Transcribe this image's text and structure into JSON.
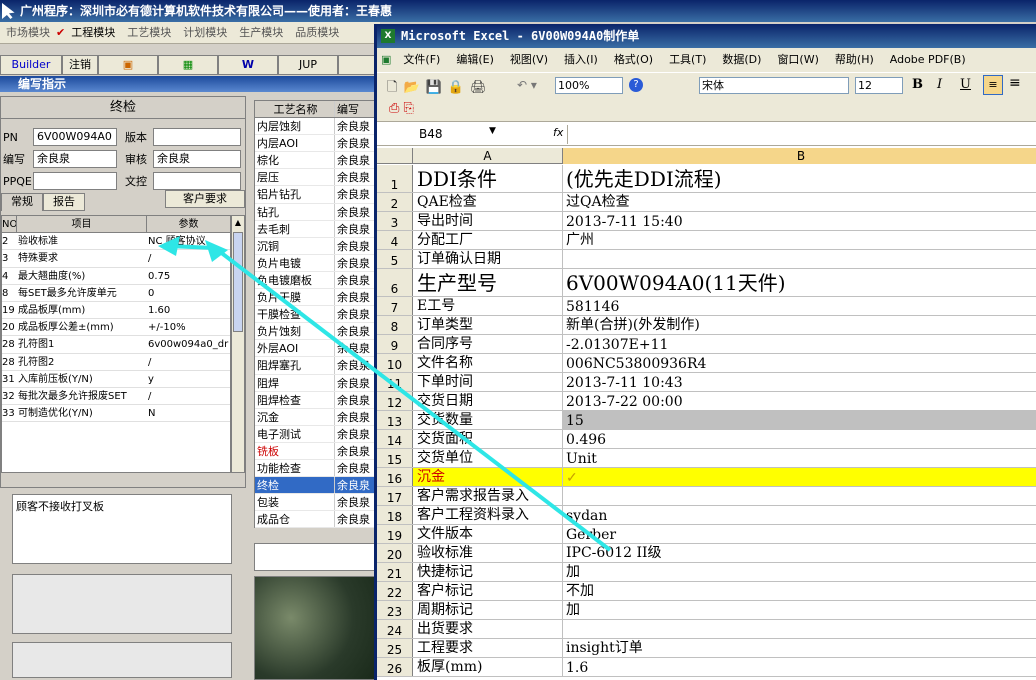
{
  "back_window": {
    "title": "广州程序：深圳市必有德计算机软件技术有限公司——使用者：王春惠",
    "menu": [
      "市场模块",
      "工程模块",
      "工艺模块",
      "计划模块",
      "生产模块",
      "品质模块"
    ],
    "toolbar": [
      "Builder",
      "注销",
      "",
      "",
      "",
      "JUP",
      ""
    ],
    "section_title": "编写指示",
    "form": {
      "header": "终检",
      "pn_label": "PN",
      "pn_value": "6V00W094A0",
      "version_label": "版本",
      "version_value": "",
      "author_label": "编写",
      "author_value": "余良泉",
      "review_label": "审核",
      "review_value": "余良泉",
      "ppqe_label": "PPQE",
      "ppqe_value": "",
      "doc_label": "文控",
      "doc_value": "",
      "tabs": [
        "常规",
        "报告",
        "客户要求"
      ],
      "grid_headers": [
        "NO",
        "项目",
        "参数"
      ],
      "grid_rows": [
        {
          "no": "2",
          "item": "验收标准",
          "param": "NC 顾客协议"
        },
        {
          "no": "3",
          "item": "特殊要求",
          "param": "/"
        },
        {
          "no": "4",
          "item": "最大翘曲度(%)",
          "param": "0.75"
        },
        {
          "no": "8",
          "item": "每SET最多允许废单元",
          "param": "0"
        },
        {
          "no": "19",
          "item": "成品板厚(mm)",
          "param": "1.60"
        },
        {
          "no": "20",
          "item": "成品板厚公差±(mm)",
          "param": "+/-10%"
        },
        {
          "no": "28",
          "item": "孔符图1",
          "param": "6v00w094a0_dr"
        },
        {
          "no": "28",
          "item": "孔符图2",
          "param": "/"
        },
        {
          "no": "31",
          "item": "入库前压板(Y/N)",
          "param": "y"
        },
        {
          "no": "32",
          "item": "每批次最多允许报废SET",
          "param": "/"
        },
        {
          "no": "33",
          "item": "可制造优化(Y/N)",
          "param": "N"
        }
      ],
      "memo_text": "顾客不接收打叉板"
    },
    "process_list": {
      "headers": [
        "工艺名称",
        "编写"
      ],
      "rows": [
        [
          "内层蚀刻",
          "余良泉"
        ],
        [
          "内层AOI",
          "余良泉"
        ],
        [
          "棕化",
          "余良泉"
        ],
        [
          "层压",
          "余良泉"
        ],
        [
          "铝片钻孔",
          "余良泉"
        ],
        [
          "钻孔",
          "余良泉"
        ],
        [
          "去毛刺",
          "余良泉"
        ],
        [
          "沉铜",
          "余良泉"
        ],
        [
          "负片电镀",
          "余良泉"
        ],
        [
          "负电镀磨板",
          "余良泉"
        ],
        [
          "负片干膜",
          "余良泉"
        ],
        [
          "干膜检查",
          "余良泉"
        ],
        [
          "负片蚀刻",
          "余良泉"
        ],
        [
          "外层AOI",
          "余良泉"
        ],
        [
          "阻焊塞孔",
          "余良泉"
        ],
        [
          "阻焊",
          "余良泉"
        ],
        [
          "阻焊检查",
          "余良泉"
        ],
        [
          "沉金",
          "余良泉"
        ],
        [
          "电子测试",
          "余良泉"
        ],
        [
          "铣板",
          "余良泉"
        ],
        [
          "功能检查",
          "余良泉"
        ],
        [
          "终检",
          "余良泉"
        ],
        [
          "包装",
          "余良泉"
        ],
        [
          "成品仓",
          "余良泉"
        ]
      ]
    }
  },
  "excel": {
    "title": "Microsoft Excel - 6V00W094A0制作单",
    "menu": [
      "文件(F)",
      "编辑(E)",
      "视图(V)",
      "插入(I)",
      "格式(O)",
      "工具(T)",
      "数据(D)",
      "窗口(W)",
      "帮助(H)",
      "Adobe PDF(B)"
    ],
    "zoom": "100%",
    "font_name": "宋体",
    "font_size": "12",
    "cell_ref": "B48",
    "fx": "fx",
    "col_a": "A",
    "col_b": "B",
    "rows": [
      {
        "n": "1",
        "a": "DDI条件",
        "b": "(优先走DDI流程)",
        "big": true
      },
      {
        "n": "2",
        "a": "QAE检查",
        "b": "过QA检查"
      },
      {
        "n": "3",
        "a": "导出时间",
        "b": "2013-7-11 15:40"
      },
      {
        "n": "4",
        "a": "分配工厂",
        "b": "广州"
      },
      {
        "n": "5",
        "a": "订单确认日期",
        "b": ""
      },
      {
        "n": "6",
        "a": "生产型号",
        "b": "6V00W094A0(11天件)",
        "big": true
      },
      {
        "n": "7",
        "a": "E工号",
        "b": "581146"
      },
      {
        "n": "8",
        "a": "订单类型",
        "b": "新单(合拼)(外发制作)"
      },
      {
        "n": "9",
        "a": "合同序号",
        "b": "-2.01307E+11"
      },
      {
        "n": "10",
        "a": "文件名称",
        "b": "006NC53800936R4"
      },
      {
        "n": "11",
        "a": "下单时间",
        "b": "2013-7-11 10:43"
      },
      {
        "n": "12",
        "a": "交货日期",
        "b": "2013-7-22 00:00"
      },
      {
        "n": "13",
        "a": "交货数量",
        "b": "15",
        "gray": true
      },
      {
        "n": "14",
        "a": "交货面积",
        "b": "0.496"
      },
      {
        "n": "15",
        "a": "交货单位",
        "b": "Unit"
      },
      {
        "n": "16",
        "a": "沉金",
        "b": "✓",
        "yellow": true
      },
      {
        "n": "17",
        "a": "客户需求报告录入",
        "b": ""
      },
      {
        "n": "18",
        "a": "客户工程资料录入",
        "b": "sydan"
      },
      {
        "n": "19",
        "a": "文件版本",
        "b": "Gerber"
      },
      {
        "n": "20",
        "a": "验收标准",
        "b": "IPC-6012 II级"
      },
      {
        "n": "21",
        "a": "快捷标记",
        "b": "加"
      },
      {
        "n": "22",
        "a": "客户标记",
        "b": "不加"
      },
      {
        "n": "23",
        "a": "周期标记",
        "b": "加"
      },
      {
        "n": "24",
        "a": "出货要求",
        "b": ""
      },
      {
        "n": "25",
        "a": "工程要求",
        "b": "insight订单"
      },
      {
        "n": "26",
        "a": "板厚(mm)",
        "b": "1.6"
      }
    ]
  }
}
